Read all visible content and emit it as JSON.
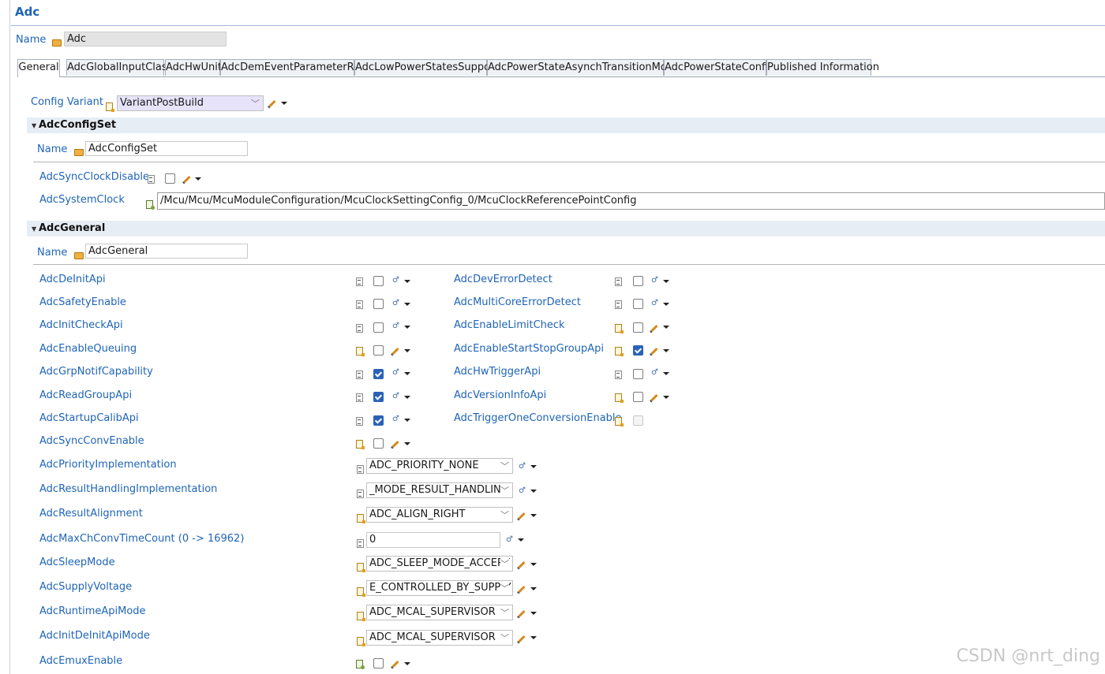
{
  "title": "Adc",
  "name_label": "Name",
  "name_value": "Adc",
  "tabs": [
    {
      "label": "General"
    },
    {
      "label": "AdcGlobalInputClass"
    },
    {
      "label": "AdcHwUnit"
    },
    {
      "label": "AdcDemEventParameterRefs"
    },
    {
      "label": "AdcLowPowerStatesSupport"
    },
    {
      "label": "AdcPowerStateAsynchTransitionMode"
    },
    {
      "label": "AdcPowerStateConfig"
    },
    {
      "label": "Published Information"
    }
  ],
  "config_variant": {
    "label": "Config Variant",
    "value": "VariantPostBuild"
  },
  "configset": {
    "title": "AdcConfigSet",
    "name_label": "Name",
    "name_value": "AdcConfigSet",
    "sync_clock_disable": {
      "label": "AdcSyncClockDisable",
      "checked": false
    },
    "system_clock": {
      "label": "AdcSystemClock",
      "value": "/Mcu/Mcu/McuModuleConfiguration/McuClockSettingConfig_0/McuClockReferencePointConfig"
    }
  },
  "general": {
    "title": "AdcGeneral",
    "name_label": "Name",
    "name_value": "AdcGeneral",
    "left_items": [
      {
        "label": "AdcDeInitApi",
        "checked": false,
        "edit": "calc"
      },
      {
        "label": "AdcSafetyEnable",
        "checked": false,
        "edit": "calc"
      },
      {
        "label": "AdcInitCheckApi",
        "checked": false,
        "edit": "calc"
      },
      {
        "label": "AdcEnableQueuing",
        "checked": false,
        "edit": "pencil"
      },
      {
        "label": "AdcGrpNotifCapability",
        "checked": true,
        "edit": "calc"
      },
      {
        "label": "AdcReadGroupApi",
        "checked": true,
        "edit": "calc"
      },
      {
        "label": "AdcStartupCalibApi",
        "checked": true,
        "edit": "calc"
      },
      {
        "label": "AdcSyncConvEnable",
        "checked": false,
        "edit": "pencil"
      }
    ],
    "right_items": [
      {
        "label": "AdcDevErrorDetect",
        "checked": false,
        "edit": "calc"
      },
      {
        "label": "AdcMultiCoreErrorDetect",
        "checked": false,
        "edit": "calc"
      },
      {
        "label": "AdcEnableLimitCheck",
        "checked": false,
        "edit": "pencil"
      },
      {
        "label": "AdcEnableStartStopGroupApi",
        "checked": true,
        "edit": "pencil"
      },
      {
        "label": "AdcHwTriggerApi",
        "checked": false,
        "edit": "calc"
      },
      {
        "label": "AdcVersionInfoApi",
        "checked": false,
        "edit": "pencil"
      },
      {
        "label": "AdcTriggerOneConversionEnable",
        "checked": false,
        "edit": "none"
      }
    ],
    "selects": [
      {
        "label": "AdcPriorityImplementation",
        "value": "ADC_PRIORITY_NONE",
        "edit": "calc"
      },
      {
        "label": "AdcResultHandlingImplementation",
        "value": "_MODE_RESULT_HANDLING",
        "edit": "calc"
      },
      {
        "label": "AdcResultAlignment",
        "value": "ADC_ALIGN_RIGHT",
        "edit": "pencil"
      },
      {
        "label": "AdcMaxChConvTimeCount (0 -> 16962)",
        "value": "0",
        "edit": "calc"
      },
      {
        "label": "AdcSleepMode",
        "value": "ADC_SLEEP_MODE_ACCEPT",
        "edit": "pencil"
      },
      {
        "label": "AdcSupplyVoltage",
        "value": "E_CONTROLLED_BY_SUPPLY",
        "edit": "pencil"
      },
      {
        "label": "AdcRuntimeApiMode",
        "value": "ADC_MCAL_SUPERVISOR",
        "edit": "pencil"
      },
      {
        "label": "AdcInitDeInitApiMode",
        "value": "ADC_MCAL_SUPERVISOR",
        "edit": "pencil"
      }
    ],
    "emux": {
      "label": "AdcEmuxEnable",
      "checked": false
    }
  },
  "watermark": "CSDN @nrt_ding"
}
